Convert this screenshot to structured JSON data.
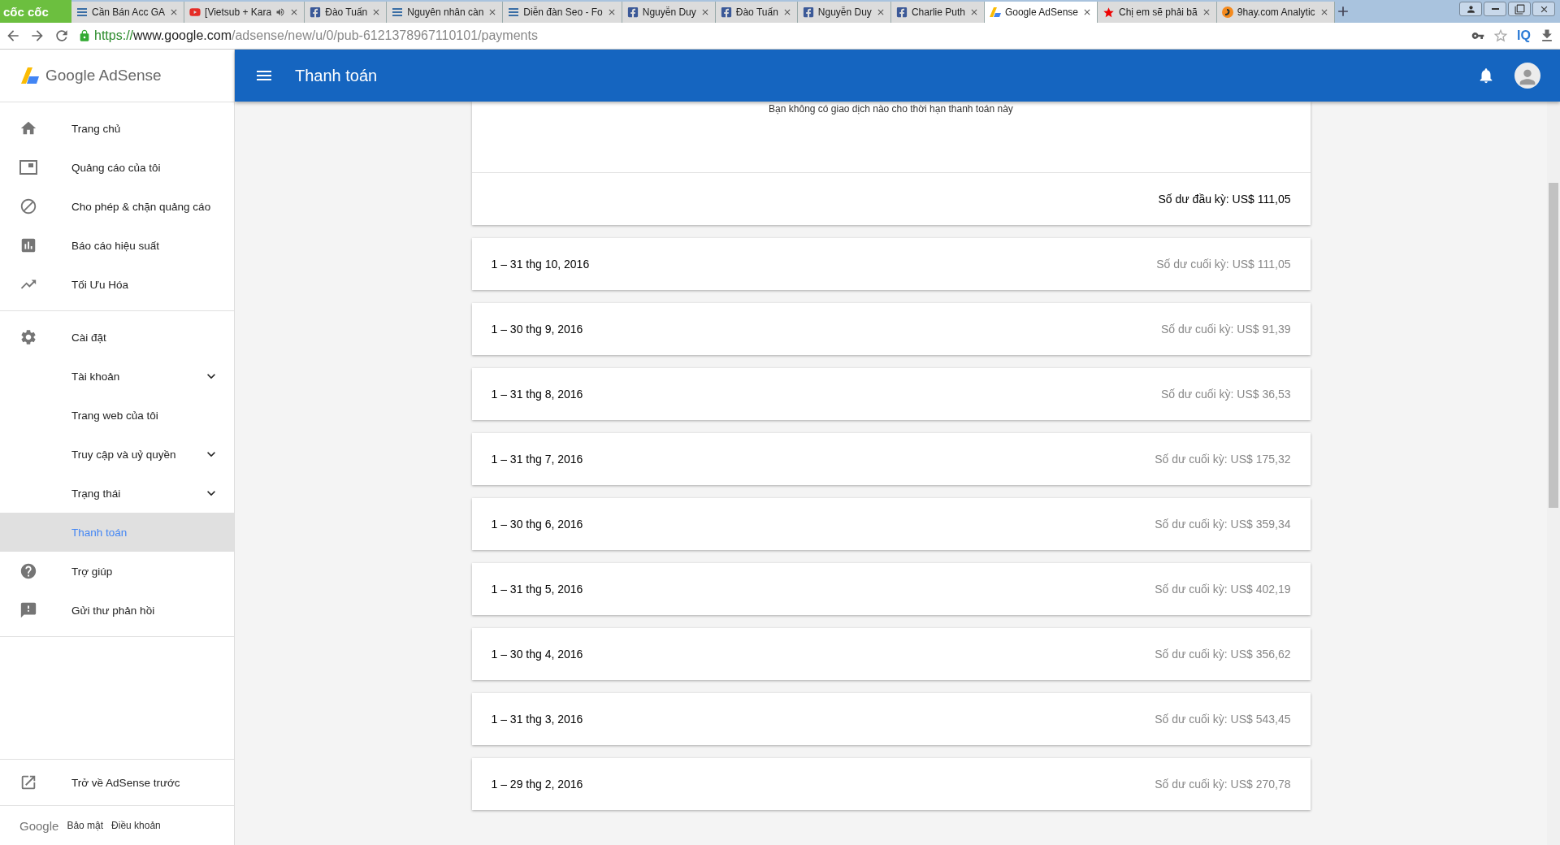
{
  "browser": {
    "brand": "cốc cốc",
    "tabs": [
      {
        "title": "Cần Bán Acc GA",
        "kind": "lines",
        "selected": false
      },
      {
        "title": "[Vietsub + Kara",
        "kind": "youtube",
        "selected": false,
        "audio": true
      },
      {
        "title": "Đào Tuấn",
        "kind": "facebook",
        "selected": false
      },
      {
        "title": "Nguyên nhân càn",
        "kind": "lines",
        "selected": false
      },
      {
        "title": "Diễn đàn Seo - Fo",
        "kind": "lines",
        "selected": false
      },
      {
        "title": "Nguyễn Duy",
        "kind": "facebook",
        "selected": false
      },
      {
        "title": "Đào Tuấn",
        "kind": "facebook",
        "selected": false
      },
      {
        "title": "Nguyễn Duy",
        "kind": "facebook",
        "selected": false
      },
      {
        "title": "Charlie Puth",
        "kind": "facebook",
        "selected": false
      },
      {
        "title": "Google AdSense",
        "kind": "adsense",
        "selected": true
      },
      {
        "title": "Chị em sẽ phải bã",
        "kind": "star",
        "selected": false
      },
      {
        "title": "9hay.com Analytic",
        "kind": "swirl",
        "selected": false
      }
    ],
    "url": {
      "scheme": "https://",
      "host": "www.google.com",
      "path": "/adsense/new/u/0/pub-6121378967110101/payments"
    },
    "extension_label": "IQ"
  },
  "sidebar": {
    "logo": "Google AdSense",
    "groups": [
      [
        {
          "label": "Trang chủ",
          "kind": "home",
          "selected": false
        },
        {
          "label": "Quảng cáo của tôi",
          "kind": "ad",
          "selected": false
        },
        {
          "label": "Cho phép & chặn quảng cáo",
          "kind": "block",
          "selected": false
        },
        {
          "label": "Báo cáo hiệu suất",
          "kind": "chart",
          "selected": false
        },
        {
          "label": "Tối Ưu Hóa",
          "kind": "trend",
          "selected": false
        }
      ],
      [
        {
          "label": "Cài đặt",
          "kind": "gear",
          "selected": false
        },
        {
          "label": "Tài khoản",
          "kind": "expandable",
          "expanded": false,
          "selected": false
        },
        {
          "label": "Trang web của tôi",
          "kind": "plain",
          "selected": false
        },
        {
          "label": "Truy cập và uỷ quyền",
          "kind": "expandable",
          "expanded": false,
          "selected": false
        },
        {
          "label": "Trạng thái",
          "kind": "expandable",
          "expanded": false,
          "selected": false
        },
        {
          "label": "Thanh toán",
          "kind": "plain",
          "selected": true
        },
        {
          "label": "Trợ giúp",
          "kind": "help",
          "selected": false
        },
        {
          "label": "Gửi thư phản hồi",
          "kind": "feedback",
          "selected": false
        }
      ]
    ],
    "bottom_link": "Trở về AdSense trước",
    "footer": {
      "brand": "Google",
      "links": [
        "Bảo mật",
        "Điều khoản"
      ]
    }
  },
  "header": {
    "title": "Thanh toán"
  },
  "summary": {
    "message": "Bạn không có giao dịch nào cho thời hạn thanh toán này",
    "opening_balance": "Số dư đầu kỳ: US$ 111,05"
  },
  "periods": [
    {
      "range": "1 – 31 thg 10, 2016",
      "balance": "Số dư cuối kỳ: US$ 111,05"
    },
    {
      "range": "1 – 30 thg 9, 2016",
      "balance": "Số dư cuối kỳ: US$ 91,39"
    },
    {
      "range": "1 – 31 thg 8, 2016",
      "balance": "Số dư cuối kỳ: US$ 36,53"
    },
    {
      "range": "1 – 31 thg 7, 2016",
      "balance": "Số dư cuối kỳ: US$ 175,32"
    },
    {
      "range": "1 – 30 thg 6, 2016",
      "balance": "Số dư cuối kỳ: US$ 359,34"
    },
    {
      "range": "1 – 31 thg 5, 2016",
      "balance": "Số dư cuối kỳ: US$ 402,19"
    },
    {
      "range": "1 – 30 thg 4, 2016",
      "balance": "Số dư cuối kỳ: US$ 356,62"
    },
    {
      "range": "1 – 31 thg 3, 2016",
      "balance": "Số dư cuối kỳ: US$ 543,45"
    },
    {
      "range": "1 – 29 thg 2, 2016",
      "balance": "Số dư cuối kỳ: US$ 270,78"
    }
  ]
}
